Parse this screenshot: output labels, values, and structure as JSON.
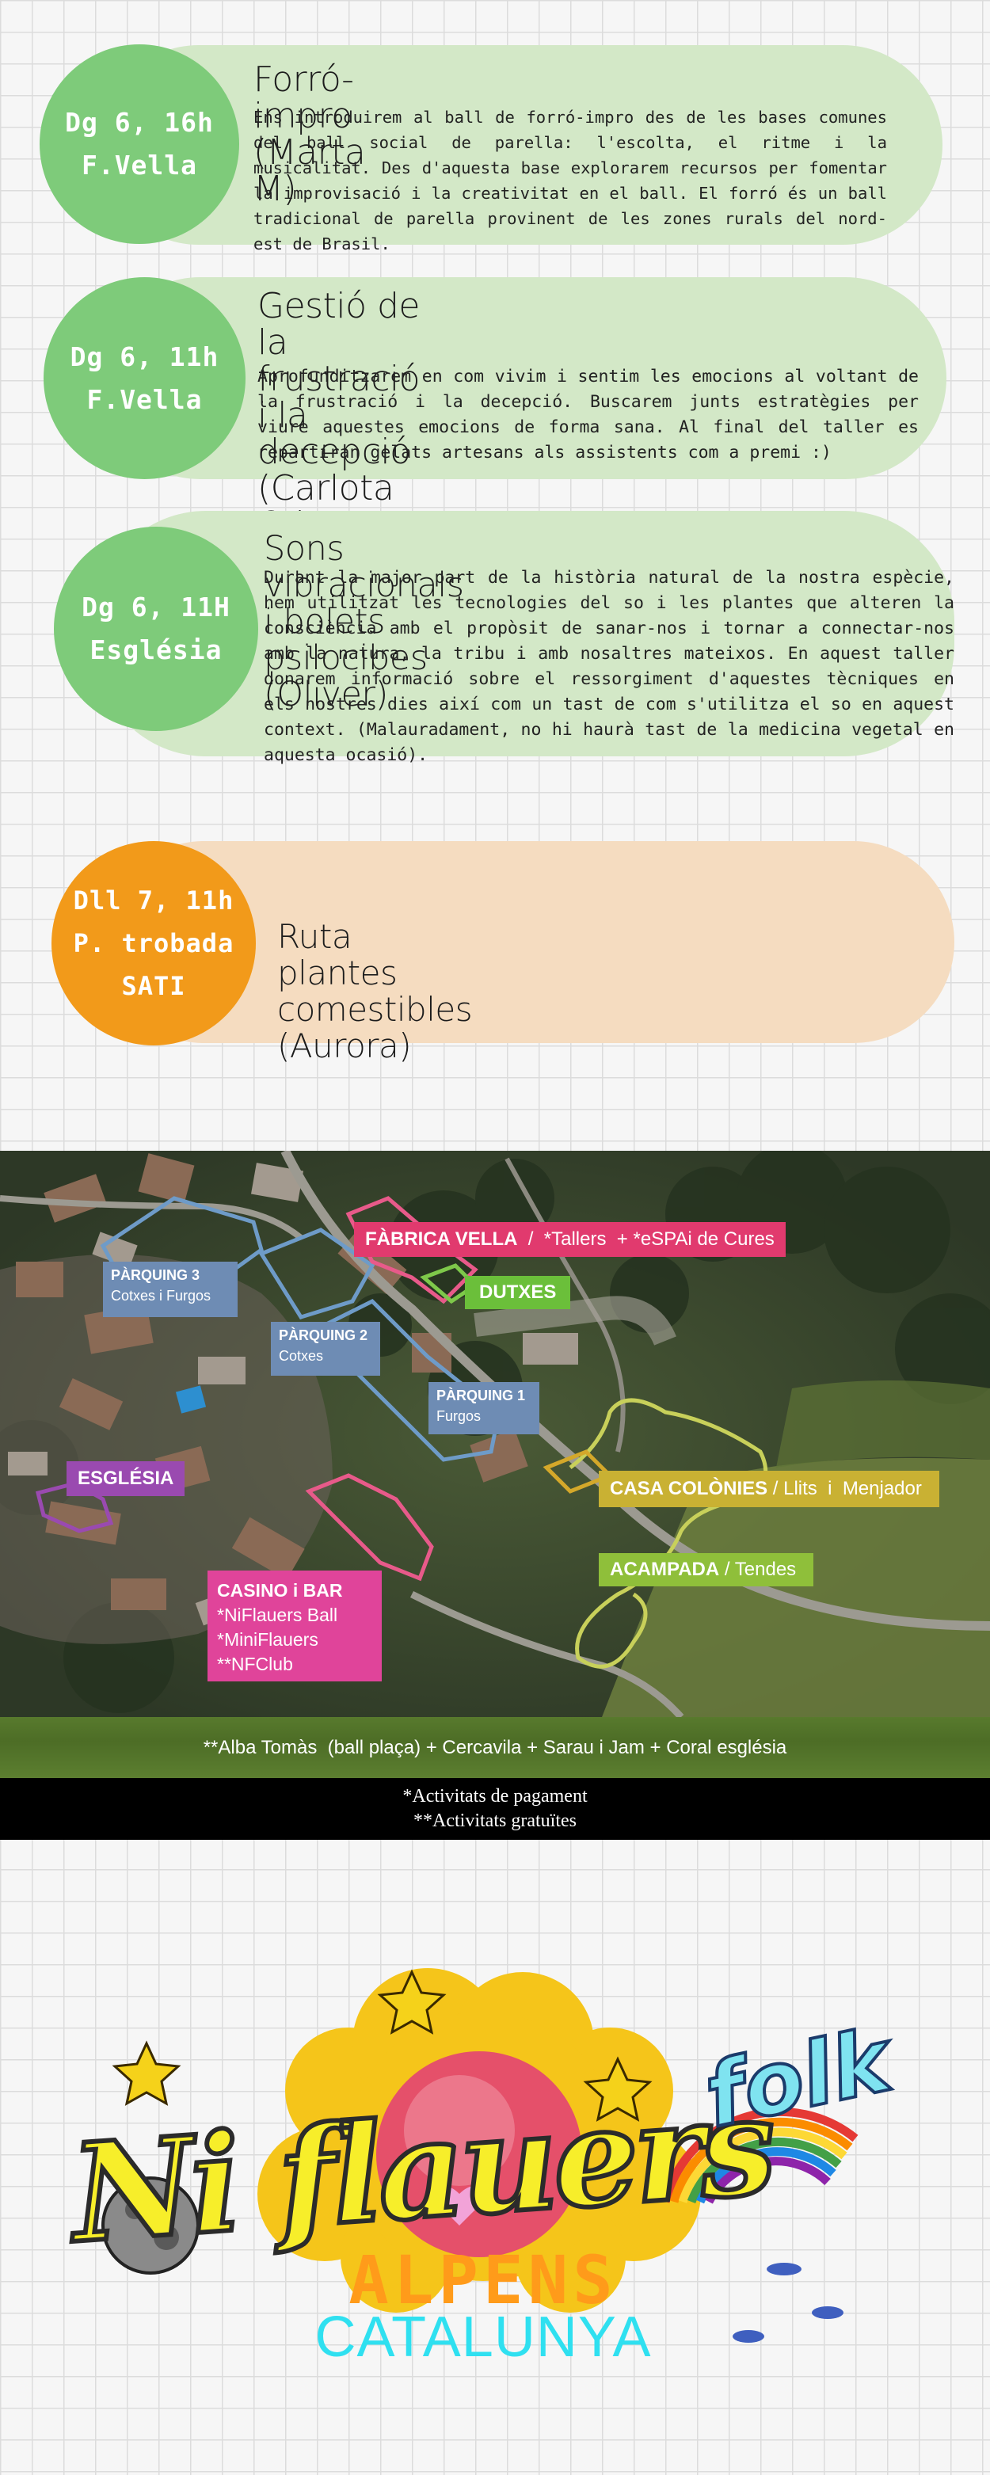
{
  "workshops": [
    {
      "circle": [
        "Dg 6, 16h",
        "F.Vella"
      ],
      "title": [
        "Forró-impro (Marta M)"
      ],
      "desc": "Ens introduirem al ball de forró-impro des de les bases comunes del ball social de parella: l'escolta, el ritme i la musicalitat. Des d'aquesta base explorarem recursos per fomentar la improvisació i la creativitat en el ball. El forró és un ball tradicional de parella provinent de les zones rurals del nord-est de Brasil."
    },
    {
      "circle": [
        "Dg 6, 11h",
        "F.Vella"
      ],
      "title": [
        "Gestió de la frustració i la decepció",
        "(Carlota O i Joan F)"
      ],
      "desc": "Aprofunditzarem en com vivim i sentim les emocions al voltant de la frustració i la decepció. Buscarem junts estratègies per viure aquestes emocions de forma sana. Al final del taller es repartiran gelats artesans als assistents com a premi :)"
    },
    {
      "circle": [
        "Dg 6, 11H",
        "Església"
      ],
      "title": [
        "Sons vibracionals i bolets psilocibes (Oliver)"
      ],
      "desc": "Durant la major part de la història natural de la nostra espècie, hem utilitzat les tecnologies del so i les plantes que alteren la consciència amb el propòsit de sanar-nos i tornar a connectar-nos amb la natura, la tribu i amb nosaltres mateixos. En aquest taller donarem informació sobre el ressorgiment d'aquestes tècniques en els nostres dies així com un tast de com s'utilitza el so en aquest context. (Malauradament, no hi haurà tast de la medicina vegetal en aquesta ocasió)."
    },
    {
      "circle": [
        "Dll 7, 11h",
        "P. trobada",
        "SATI"
      ],
      "title": [
        "Ruta plantes comestibles (Aurora)"
      ],
      "desc": ""
    }
  ],
  "map": {
    "fabrica": {
      "bold": "FÀBRICA VELLA",
      "rest": "  /  *Tallers  + *eSPAi de Cures"
    },
    "dutxes": "DUTXES",
    "parquing3": {
      "title": "PÀRQUING 3",
      "sub": "Cotxes i Furgos"
    },
    "parquing2": {
      "title": "PÀRQUING 2",
      "sub": "Cotxes"
    },
    "parquing1": {
      "title": "PÀRQUING 1",
      "sub": "Furgos"
    },
    "esglesia": "ESGLÉSIA",
    "colonies": {
      "bold": "CASA COLÒNIES",
      "rest": " / Llits  i  Menjador"
    },
    "acampada": {
      "bold": "ACAMPADA",
      "rest": " / Tendes"
    },
    "casino": {
      "title": "CASINO i BAR",
      "lines": [
        "*NiFlauers Ball",
        "*MiniFlauers",
        "**NFClub"
      ]
    }
  },
  "grass_text": "**Alba Tomàs  (ball plaça) + Cercavila + Sarau i Jam + Coral església",
  "notes": [
    "*Activitats de pagament",
    "**Activitats gratuïtes"
  ],
  "logo": {
    "line1": "Ni flauers",
    "folk": "folk",
    "line2": "ALPENS",
    "line3": "CATALUNYA"
  },
  "colors": {
    "green_circle": "#7ecb7a",
    "green_pill": "#d3e8c7",
    "orange_circle": "#f29a1a",
    "orange_pill": "#f5dcc0"
  }
}
